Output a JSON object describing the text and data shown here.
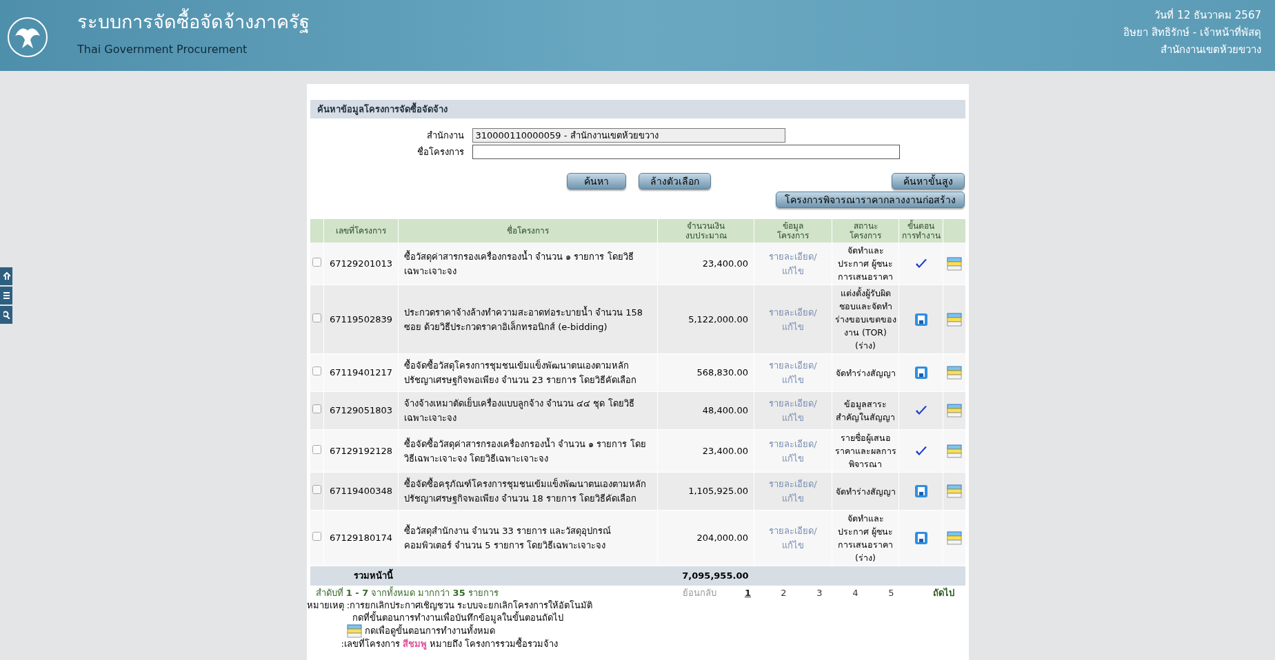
{
  "header": {
    "title": "ระบบการจัดซื้อจัดจ้างภาครัฐ",
    "subtitle": "Thai Government Procurement",
    "date": "วันที่ 12 ธันวาคม 2567",
    "user": "อิษยา สิทธิรักษ์ - เจ้าหน้าที่พัสดุ",
    "office": "สำนักงานเขตห้วยขวาง"
  },
  "side_tabs": [
    {
      "kind": "home"
    },
    {
      "kind": "list"
    },
    {
      "kind": "search"
    }
  ],
  "search_panel": {
    "title": "ค้นหาข้อมูลโครงการจัดซื้อจัดจ้าง",
    "fields": [
      {
        "label": "สำนักงาน",
        "value": "310000110000059 - สำนักงานเขตห้วยขวาง",
        "disabled": true
      },
      {
        "label": "ชื่อโครงการ",
        "disabled": false
      }
    ],
    "buttons": [
      "ค้นหา",
      "ล้างตัวเลือก"
    ],
    "advanced_button": "ค้นหาขั้นสูง",
    "price_button": "โครงการพิจารณาราคากลางงานก่อสร้าง"
  },
  "table": {
    "columns": [
      "เลขที่โครงการ",
      "ชื่อโครงการ",
      "จำนวนเงิน\nงบประมาณ",
      "ข้อมูล\nโครงการ",
      "สถานะ\nโครงการ",
      "ขั้นตอน\nการทำงาน"
    ],
    "rows": [
      {
        "checked": false,
        "number": "67129201013",
        "name": "ซื้อวัสดุค่าสารกรองเครื่องกรองน้ำ จำนวน ๑ รายการ โดยวิธีเฉพาะเจาะจง",
        "amount": "23,400.00",
        "link": "รายละเอียด/\nแก้ไข",
        "status": "จัดทำและ\nประกาศ ผู้ชนะ\nการเสนอราคา",
        "kind": "check"
      },
      {
        "checked": false,
        "number": "67119502839",
        "name": "ประกวดราคาจ้างล้างทำความสะอาดท่อระบายน้ำ จำนวน 158 ซอย ด้วยวิธีประกวดราคาอิเล็กทรอนิกส์ (e-bidding)",
        "amount": "5,122,000.00",
        "link": "รายละเอียด/\nแก้ไข",
        "status": "แต่งตั้งผู้รับผิด\nชอบและจัดทำ\nร่างขอบเขตของ\nงาน (TOR)\n(ร่าง)",
        "kind": "form"
      },
      {
        "checked": false,
        "number": "67119401217",
        "name": "ซื้อจัดซื้อวัสดุโครงการชุมชนเข้มแข็งพัฒนาตนเองตามหลักปรัชญาเศรษฐกิจพอเพียง จำนวน 23 รายการ โดยวิธีคัดเลือก",
        "amount": "568,830.00",
        "link": "รายละเอียด/\nแก้ไข",
        "status": "จัดทำร่างสัญญา",
        "kind": "form"
      },
      {
        "checked": false,
        "number": "67129051803",
        "name": "จ้างจ้างเหมาตัดเย็บเครื่องแบบลูกจ้าง จำนวน ๔๔ ชุด โดยวิธีเฉพาะเจาะจง",
        "amount": "48,400.00",
        "link": "รายละเอียด/\nแก้ไข",
        "status": "ข้อมูลสาระ\nสำคัญในสัญญา",
        "kind": "check"
      },
      {
        "checked": false,
        "number": "67129192128",
        "name": "ซื้อจัดซื้อวัสดุค่าสารกรองเครื่องกรองน้ำ จำนวน ๑ รายการ โดยวิธีเฉพาะเจาะจง โดยวิธีเฉพาะเจาะจง",
        "amount": "23,400.00",
        "link": "รายละเอียด/\nแก้ไข",
        "status": "รายชื่อผู้เสนอ\nราคาและผลการ\nพิจารณา",
        "kind": "check"
      },
      {
        "checked": false,
        "number": "67119400348",
        "name": "ซื้อจัดซื้อครุภัณฑ์โครงการชุมชนเข้มแข็งพัฒนาตนเองตามหลักปรัชญาเศรษฐกิจพอเพียง จำนวน 18 รายการ โดยวิธีคัดเลือก",
        "amount": "1,105,925.00",
        "link": "รายละเอียด/\nแก้ไข",
        "status": "จัดทำร่างสัญญา",
        "kind": "form"
      },
      {
        "checked": false,
        "number": "67129180174",
        "name": "ซื้อวัสดุสำนักงาน จำนวน 33 รายการ และวัสดุอุปกรณ์คอมพิวเตอร์ จำนวน 5 รายการ โดยวิธีเฉพาะเจาะจง",
        "amount": "204,000.00",
        "link": "รายละเอียด/\nแก้ไข",
        "status": "จัดทำและ\nประกาศ ผู้ชนะ\nการเสนอราคา\n(ร่าง)",
        "kind": "form"
      }
    ],
    "total_label": "รวมหน้านี้",
    "total": "7,095,955.00"
  },
  "pagination": {
    "summary": "สำดับที่ **1 - 7** จากทั้งหมด มากกว่า **35** รายการ",
    "prev": "ย้อนกลับ",
    "pages": [
      {
        "label": "1",
        "selected": true
      },
      {
        "label": "2",
        "selected": false
      },
      {
        "label": "3",
        "selected": false
      },
      {
        "label": "4",
        "selected": false
      },
      {
        "label": "5",
        "selected": false
      }
    ],
    "next": "ถัดไป"
  },
  "notes": {
    "label": "หมายเหตุ :",
    "lines": [
      "การยกเลิกประกาศเชิญชวน ระบบจะยกเลิกโครงการให้อัตโนมัติ",
      "กดที่ขั้นตอนการทำงานเพื่อบันทึกข้อมูลในขั้นตอนถัดไป"
    ],
    "icon_line": "กดเพื่อดูขั้นตอนการทำงานทั้งหมด",
    "color_note": {
      "before": ":เลขที่โครงการ",
      "highlight": "สีชมพู",
      "after": "หมายถึง โครงการรวมซื้อรวมจ้าง",
      "color": "#e0529c"
    }
  }
}
